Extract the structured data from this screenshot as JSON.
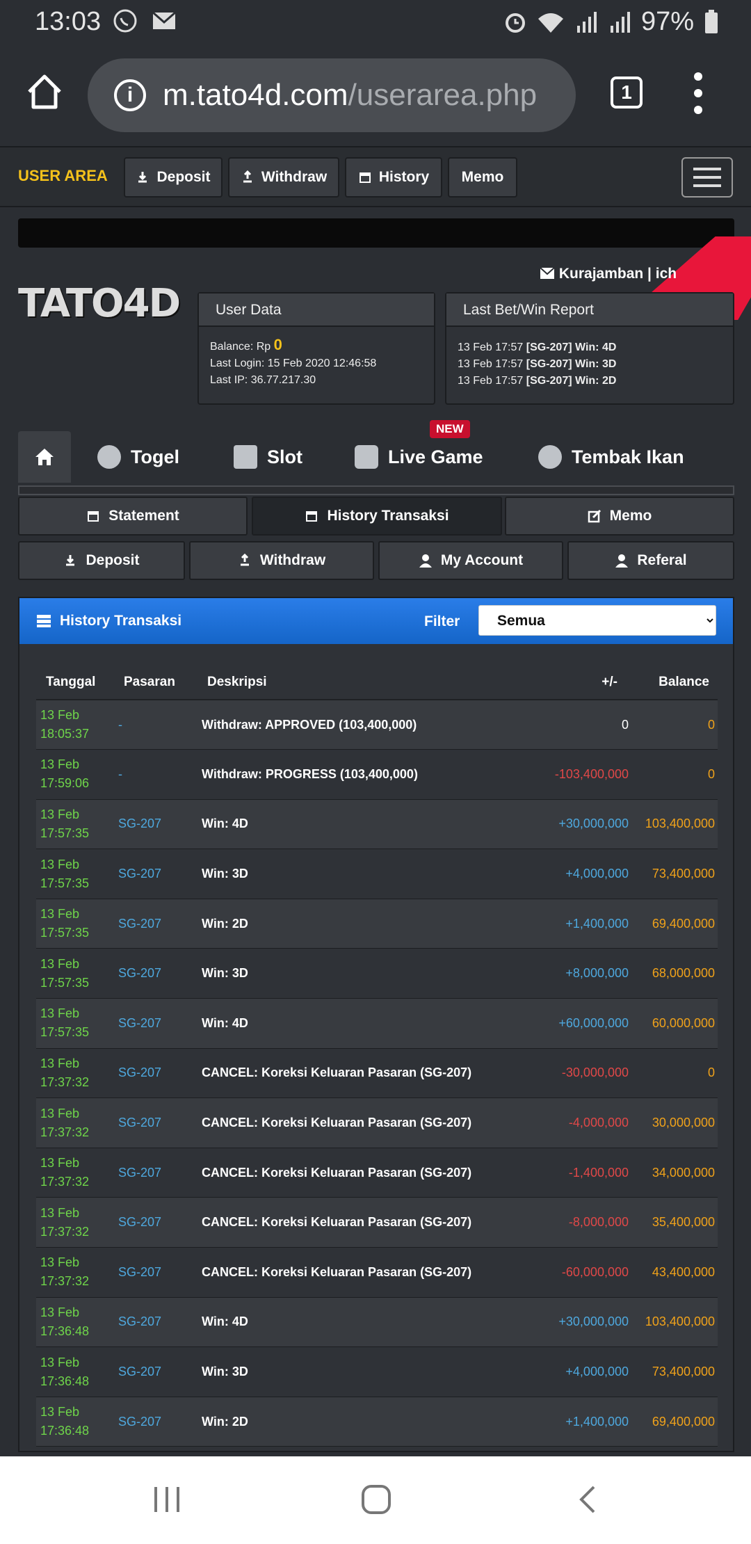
{
  "status": {
    "time": "13:03",
    "battery": "97%"
  },
  "browser": {
    "url_host": "m.tato4d.com",
    "url_path": "/userarea.php",
    "tab_count": "1"
  },
  "topnav": {
    "brand": "USER AREA",
    "deposit": "Deposit",
    "withdraw": "Withdraw",
    "history": "History",
    "memo": "Memo"
  },
  "userline": "Kurajamban | ich",
  "logo": "TATO4D",
  "userdata": {
    "title": "User Data",
    "balance_label": "Balance: Rp",
    "balance_value": "0",
    "last_login": "Last Login: 15 Feb 2020 12:46:58",
    "last_ip": "Last IP: 36.77.217.30"
  },
  "lastbet": {
    "title": "Last Bet/Win Report",
    "lines": [
      {
        "date": "13 Feb 17:57",
        "code": "[SG-207] Win: 4D"
      },
      {
        "date": "13 Feb 17:57",
        "code": "[SG-207] Win: 3D"
      },
      {
        "date": "13 Feb 17:57",
        "code": "[SG-207] Win: 2D"
      }
    ]
  },
  "gametabs": {
    "togel": "Togel",
    "slot": "Slot",
    "live": "Live Game",
    "new": "NEW",
    "ikan": "Tembak Ikan"
  },
  "subnav": {
    "statement": "Statement",
    "history": "History Transaksi",
    "memo": "Memo",
    "deposit": "Deposit",
    "withdraw": "Withdraw",
    "account": "My Account",
    "referal": "Referal"
  },
  "history": {
    "title": "History Transaksi",
    "filter_label": "Filter",
    "filter_value": "Semua",
    "columns": {
      "tanggal": "Tanggal",
      "pasaran": "Pasaran",
      "deskripsi": "Deskripsi",
      "amount": "+/-",
      "balance": "Balance"
    },
    "rows": [
      {
        "d1": "13 Feb",
        "d2": "18:05:37",
        "pasaran": "-",
        "desc": "Withdraw: APPROVED (103,400,000)",
        "amount": "0",
        "type": "zero",
        "balance": "0"
      },
      {
        "d1": "13 Feb",
        "d2": "17:59:06",
        "pasaran": "-",
        "desc": "Withdraw: PROGRESS (103,400,000)",
        "amount": "-103,400,000",
        "type": "neg",
        "balance": "0"
      },
      {
        "d1": "13 Feb",
        "d2": "17:57:35",
        "pasaran": "SG-207",
        "desc": "Win: 4D",
        "amount": "+30,000,000",
        "type": "pos",
        "balance": "103,400,000"
      },
      {
        "d1": "13 Feb",
        "d2": "17:57:35",
        "pasaran": "SG-207",
        "desc": "Win: 3D",
        "amount": "+4,000,000",
        "type": "pos",
        "balance": "73,400,000"
      },
      {
        "d1": "13 Feb",
        "d2": "17:57:35",
        "pasaran": "SG-207",
        "desc": "Win: 2D",
        "amount": "+1,400,000",
        "type": "pos",
        "balance": "69,400,000"
      },
      {
        "d1": "13 Feb",
        "d2": "17:57:35",
        "pasaran": "SG-207",
        "desc": "Win: 3D",
        "amount": "+8,000,000",
        "type": "pos",
        "balance": "68,000,000"
      },
      {
        "d1": "13 Feb",
        "d2": "17:57:35",
        "pasaran": "SG-207",
        "desc": "Win: 4D",
        "amount": "+60,000,000",
        "type": "pos",
        "balance": "60,000,000"
      },
      {
        "d1": "13 Feb",
        "d2": "17:37:32",
        "pasaran": "SG-207",
        "desc": "CANCEL: Koreksi Keluaran Pasaran (SG-207)",
        "amount": "-30,000,000",
        "type": "neg",
        "balance": "0"
      },
      {
        "d1": "13 Feb",
        "d2": "17:37:32",
        "pasaran": "SG-207",
        "desc": "CANCEL: Koreksi Keluaran Pasaran (SG-207)",
        "amount": "-4,000,000",
        "type": "neg",
        "balance": "30,000,000"
      },
      {
        "d1": "13 Feb",
        "d2": "17:37:32",
        "pasaran": "SG-207",
        "desc": "CANCEL: Koreksi Keluaran Pasaran (SG-207)",
        "amount": "-1,400,000",
        "type": "neg",
        "balance": "34,000,000"
      },
      {
        "d1": "13 Feb",
        "d2": "17:37:32",
        "pasaran": "SG-207",
        "desc": "CANCEL: Koreksi Keluaran Pasaran (SG-207)",
        "amount": "-8,000,000",
        "type": "neg",
        "balance": "35,400,000"
      },
      {
        "d1": "13 Feb",
        "d2": "17:37:32",
        "pasaran": "SG-207",
        "desc": "CANCEL: Koreksi Keluaran Pasaran (SG-207)",
        "amount": "-60,000,000",
        "type": "neg",
        "balance": "43,400,000"
      },
      {
        "d1": "13 Feb",
        "d2": "17:36:48",
        "pasaran": "SG-207",
        "desc": "Win: 4D",
        "amount": "+30,000,000",
        "type": "pos",
        "balance": "103,400,000"
      },
      {
        "d1": "13 Feb",
        "d2": "17:36:48",
        "pasaran": "SG-207",
        "desc": "Win: 3D",
        "amount": "+4,000,000",
        "type": "pos",
        "balance": "73,400,000"
      },
      {
        "d1": "13 Feb",
        "d2": "17:36:48",
        "pasaran": "SG-207",
        "desc": "Win: 2D",
        "amount": "+1,400,000",
        "type": "pos",
        "balance": "69,400,000"
      }
    ]
  },
  "colors": {
    "brand": "#f5c21b",
    "positive": "#4ea8de",
    "negative": "#e04848",
    "date": "#6fd54a",
    "balance": "#f0a21a",
    "header_blue": "#1565c8"
  }
}
